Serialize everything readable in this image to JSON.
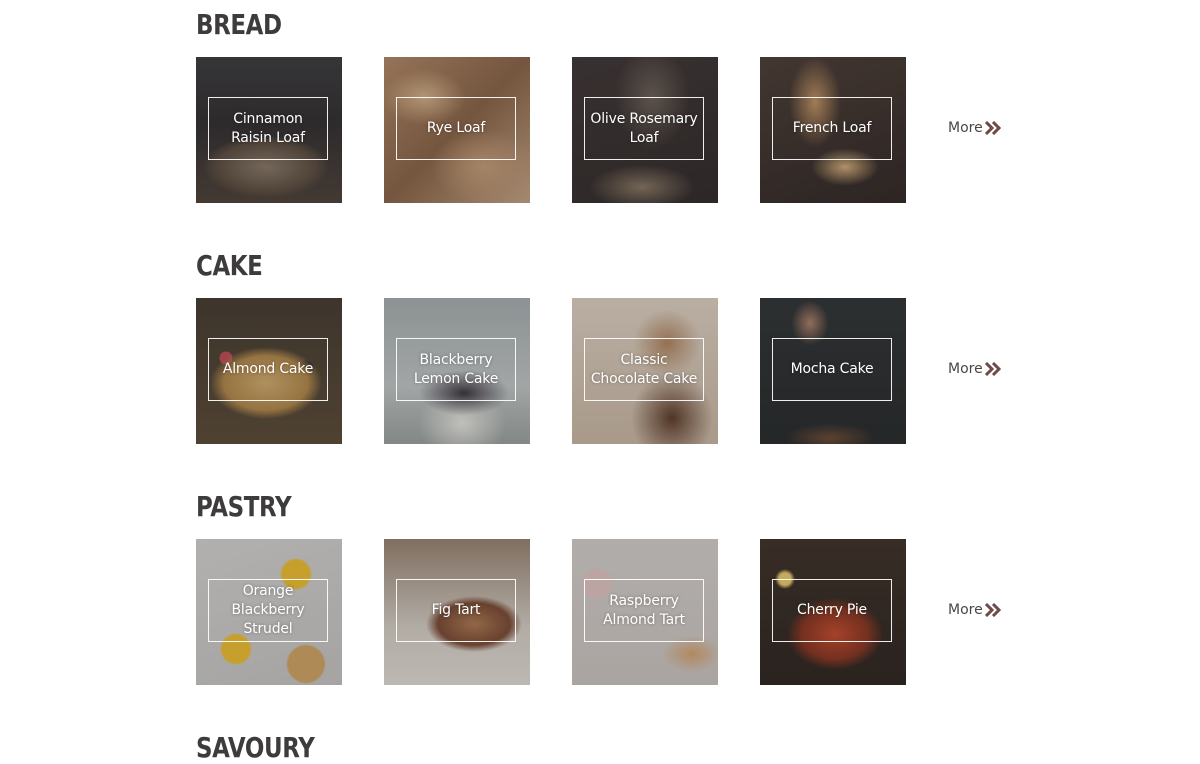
{
  "sections": [
    {
      "title": "BREAD",
      "items": [
        "Cinnamon Raisin Loaf",
        "Rye Loaf",
        "Olive Rosemary Loaf",
        "French Loaf"
      ],
      "more_label": "More"
    },
    {
      "title": "CAKE",
      "items": [
        "Almond Cake",
        "Blackberry Lemon Cake",
        "Classic Chocolate Cake",
        "Mocha Cake"
      ],
      "more_label": "More"
    },
    {
      "title": "PASTRY",
      "items": [
        "Orange Blackberry Strudel",
        "Fig Tart",
        "Raspberry Almond Tart",
        "Cherry Pie"
      ],
      "more_label": "More"
    },
    {
      "title": "SAVOURY"
    }
  ],
  "icons": {
    "more": "double-chevron-right-icon"
  },
  "colors": {
    "heading": "#3d3b3b",
    "more_text": "#4a4646",
    "more_icon": "#6e4a4a",
    "background": "#ffffff"
  }
}
